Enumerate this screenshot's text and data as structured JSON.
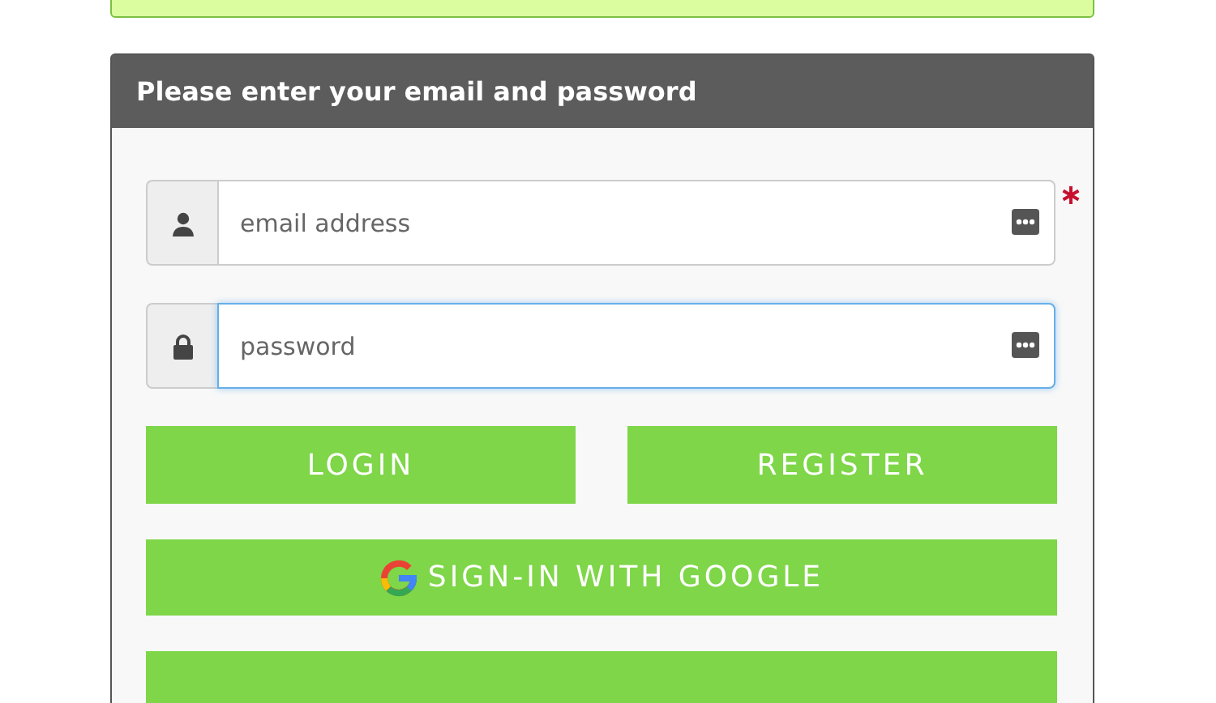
{
  "panel": {
    "title": "Please enter your email and password"
  },
  "fields": [
    {
      "kind": "user",
      "placeholder": "email address",
      "required": true,
      "focused": false
    },
    {
      "kind": "lock",
      "placeholder": "password",
      "required": false,
      "focused": true
    }
  ],
  "buttons": [
    {
      "label": "LOGIN",
      "kind": "half"
    },
    {
      "label": "REGISTER",
      "kind": "half"
    },
    {
      "label": "SIGN-IN WITH GOOGLE",
      "kind": "google"
    },
    {
      "kind": "cut"
    }
  ]
}
